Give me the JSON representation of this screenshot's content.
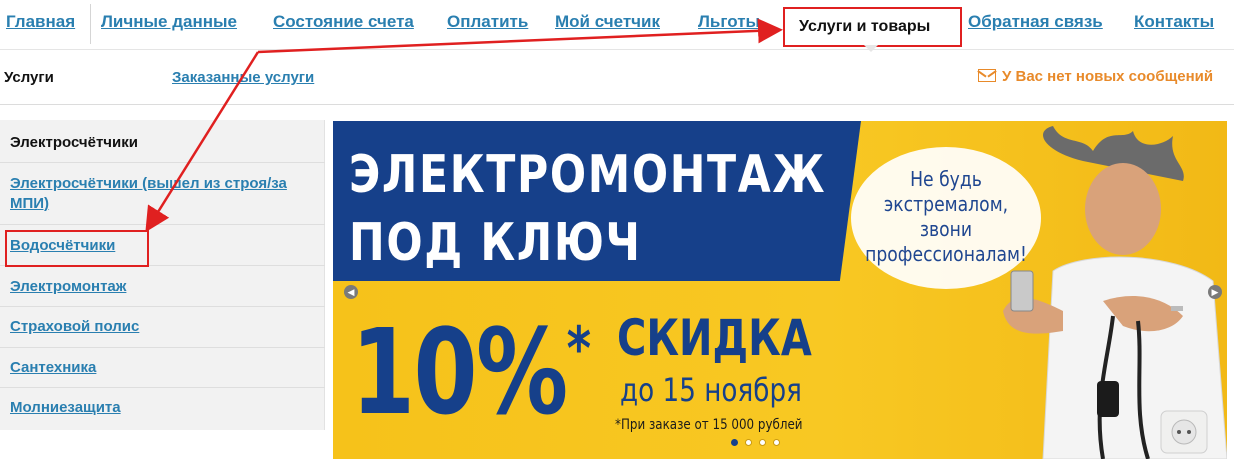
{
  "nav": {
    "items": [
      "Главная",
      "Личные данные",
      "Состояние счета",
      "Оплатить",
      "Мой счетчик",
      "Льготы"
    ],
    "active": "Услуги и товары",
    "after": [
      "Обратная связь",
      "Контакты"
    ]
  },
  "subnav": {
    "current": "Услуги",
    "link": "Заказанные услуги",
    "messages": "У Вас нет новых сообщений"
  },
  "sidebar": {
    "items": [
      {
        "label": "Электросчётчики",
        "current": true
      },
      {
        "label": "Электросчётчики (вышел из строя/за МПИ)",
        "current": false
      },
      {
        "label": "Водосчётчики",
        "current": false
      },
      {
        "label": "Электромонтаж",
        "current": false
      },
      {
        "label": "Страховой полис",
        "current": false
      },
      {
        "label": "Сантехника",
        "current": false
      },
      {
        "label": "Молниезащита",
        "current": false
      }
    ]
  },
  "banner": {
    "title_line1": "ЭЛЕКТРОМОНТАЖ",
    "title_line2": "ПОД КЛЮЧ",
    "bubble_line1": "Не будь",
    "bubble_line2": "экстремалом,",
    "bubble_line3": "звони",
    "bubble_line4": "профессионалам!",
    "percent": "10%",
    "asterisk": "*",
    "discount": "СКИДКА",
    "until": "до 15 ноября",
    "note": "*При заказе от 15 000 рублей",
    "active_slide": 1,
    "slide_count": 4
  },
  "colors": {
    "link": "#2a7fb0",
    "highlight": "#e02020",
    "banner_blue": "#16408a",
    "banner_yellow": "#f6c21a",
    "messages": "#e88a2a"
  }
}
